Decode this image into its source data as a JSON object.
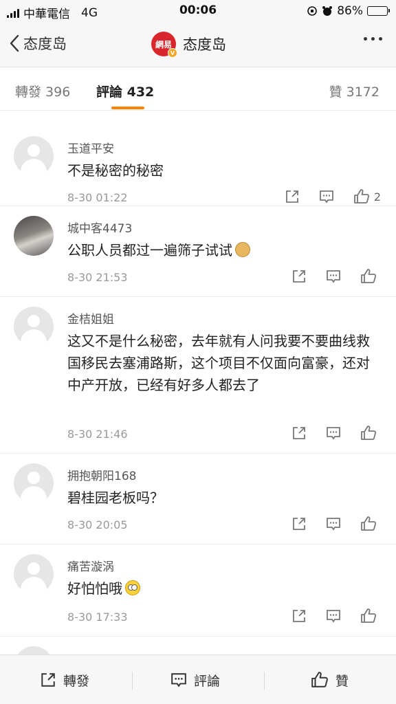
{
  "status_bar": {
    "carrier": "中華電信",
    "network": "4G",
    "time": "00:06",
    "battery_percent": "86%",
    "battery_level": 0.86
  },
  "nav": {
    "back_label": "态度岛",
    "logo_text": "網易",
    "title": "态度岛"
  },
  "tabs": {
    "repost": "轉發 396",
    "comment": "評論 432",
    "like": "贊 3172"
  },
  "comments": [
    {
      "username": "玉道平安",
      "text": "不是秘密的秘密",
      "emoji": "",
      "time": "8-30 01:22",
      "likes": "2"
    },
    {
      "username": "城中客4473",
      "text": "公职人员都过一遍筛子试试",
      "emoji": "doge",
      "time": "8-30 21:53",
      "likes": ""
    },
    {
      "username": "金桔姐姐",
      "text": "这又不是什么秘密，去年就有人问我要不要曲线救国移民去塞浦路斯，这个项目不仅面向富豪，还对中产开放，已经有好多人都去了",
      "emoji": "",
      "time": "8-30 21:46",
      "likes": ""
    },
    {
      "username": "拥抱朝阳168",
      "text": "碧桂园老板吗？",
      "emoji": "",
      "time": "8-30 20:05",
      "likes": ""
    },
    {
      "username": "痛苦漩涡",
      "text": "好怕怕哦",
      "emoji": "eye-roll",
      "time": "8-30 17:33",
      "likes": ""
    }
  ],
  "bottom_bar": {
    "repost": "轉發",
    "comment": "評論",
    "like": "贊"
  },
  "colors": {
    "accent": "#ff8200",
    "brand": "#d9252c"
  }
}
